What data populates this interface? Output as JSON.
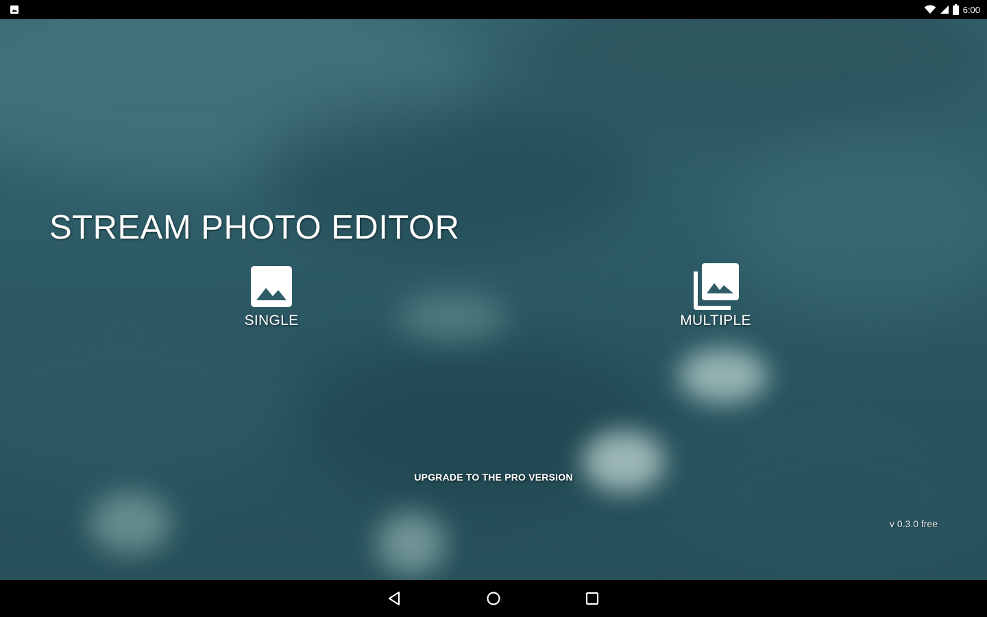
{
  "status_bar": {
    "time": "6:00",
    "icons": [
      "notification-icon",
      "wifi-icon",
      "signal-icon",
      "battery-icon"
    ]
  },
  "app": {
    "title": "STREAM PHOTO EDITOR",
    "single_label": "SINGLE",
    "multiple_label": "MULTIPLE",
    "upgrade_label": "UPGRADE TO THE PRO VERSION",
    "version": "v 0.3.0 free"
  },
  "icons": {
    "single": "image-icon",
    "multiple": "photo-library-icon"
  },
  "nav_bar": {
    "buttons": [
      "back-icon",
      "home-icon",
      "recents-icon"
    ]
  },
  "colors": {
    "background_teal": "#2e5d68",
    "text": "#ffffff",
    "bars": "#000000"
  }
}
